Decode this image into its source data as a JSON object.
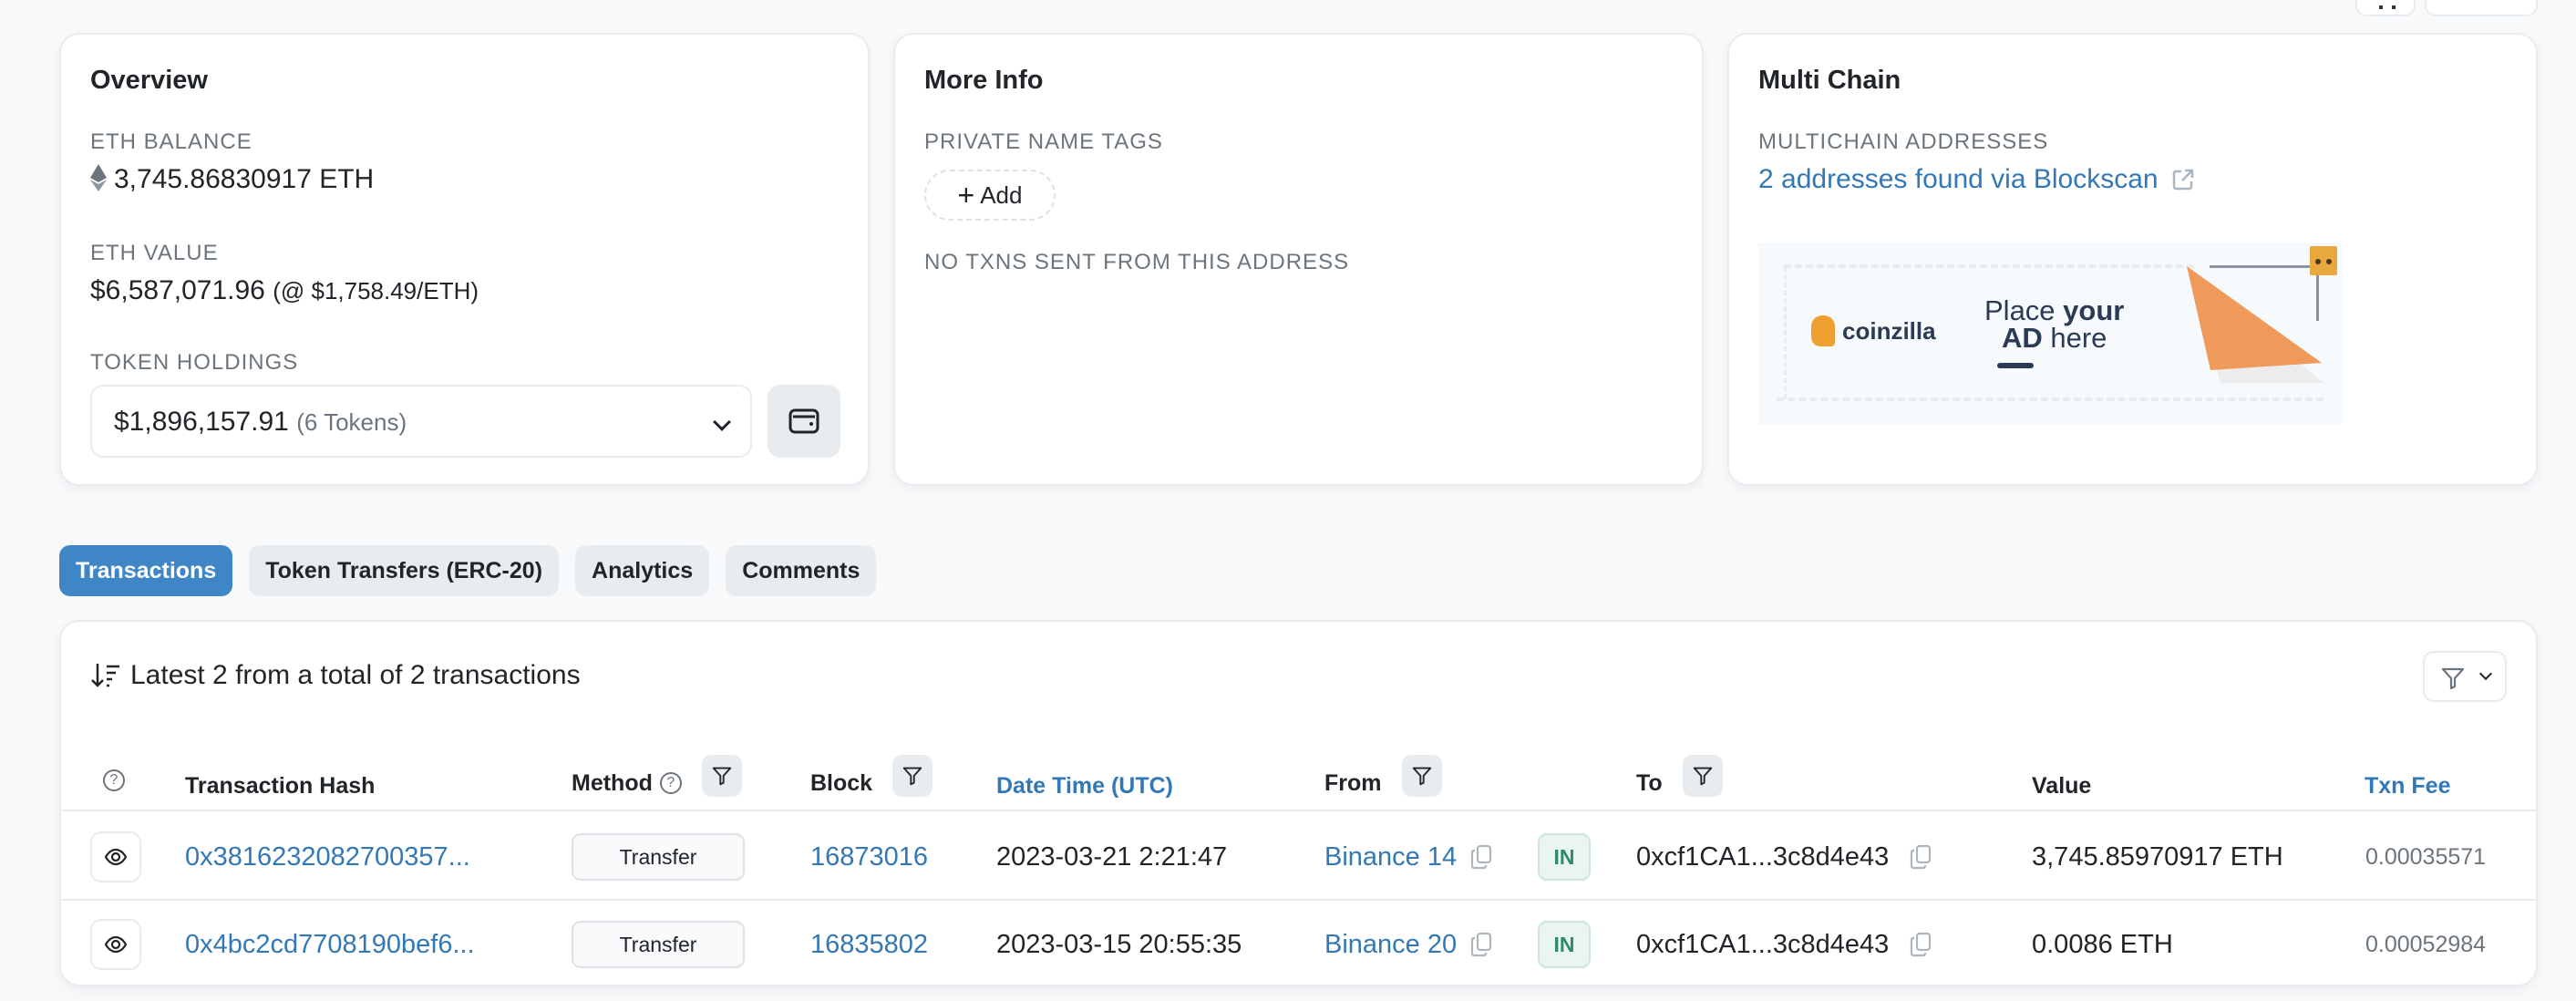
{
  "overview": {
    "title": "Overview",
    "eth_balance_label": "ETH BALANCE",
    "eth_balance": "3,745.86830917 ETH",
    "eth_value_label": "ETH VALUE",
    "eth_value": "$6,587,071.96",
    "eth_price": "(@ $1,758.49/ETH)",
    "token_holdings_label": "TOKEN HOLDINGS",
    "token_holdings_value": "$1,896,157.91",
    "token_holdings_count": "(6 Tokens)"
  },
  "more_info": {
    "title": "More Info",
    "private_name_tags_label": "PRIVATE NAME TAGS",
    "add_label": "Add",
    "no_txns_label": "NO TXNS SENT FROM THIS ADDRESS"
  },
  "multi_chain": {
    "title": "Multi Chain",
    "addresses_label": "MULTICHAIN ADDRESSES",
    "addresses_link": "2 addresses found via Blockscan",
    "ad": {
      "brand": "coinzilla",
      "line1_a": "Place ",
      "line1_b": "your",
      "line2_a": "AD",
      "line2_b": " here"
    }
  },
  "tabs": [
    {
      "label": "Transactions",
      "active": true
    },
    {
      "label": "Token Transfers (ERC-20)",
      "active": false
    },
    {
      "label": "Analytics",
      "active": false
    },
    {
      "label": "Comments",
      "active": false
    }
  ],
  "table": {
    "summary": "Latest 2 from a total of 2 transactions",
    "columns": {
      "hash": "Transaction Hash",
      "method": "Method",
      "block": "Block",
      "datetime": "Date Time (UTC)",
      "from": "From",
      "to": "To",
      "value": "Value",
      "fee": "Txn Fee"
    },
    "rows": [
      {
        "hash": "0x3816232082700357...",
        "method": "Transfer",
        "block": "16873016",
        "datetime": "2023-03-21 2:21:47",
        "from": "Binance 14",
        "direction": "IN",
        "to": "0xcf1CA1...3c8d4e43",
        "value": "3,745.85970917 ETH",
        "fee": "0.00035571"
      },
      {
        "hash": "0x4bc2cd7708190bef6...",
        "method": "Transfer",
        "block": "16835802",
        "datetime": "2023-03-15 20:55:35",
        "from": "Binance 20",
        "direction": "IN",
        "to": "0xcf1CA1...3c8d4e43",
        "value": "0.0086 ETH",
        "fee": "0.00052984"
      }
    ]
  },
  "colors": {
    "accent": "#3f86c6",
    "link": "#3378b6",
    "in_badge": "#2e8b6a"
  }
}
